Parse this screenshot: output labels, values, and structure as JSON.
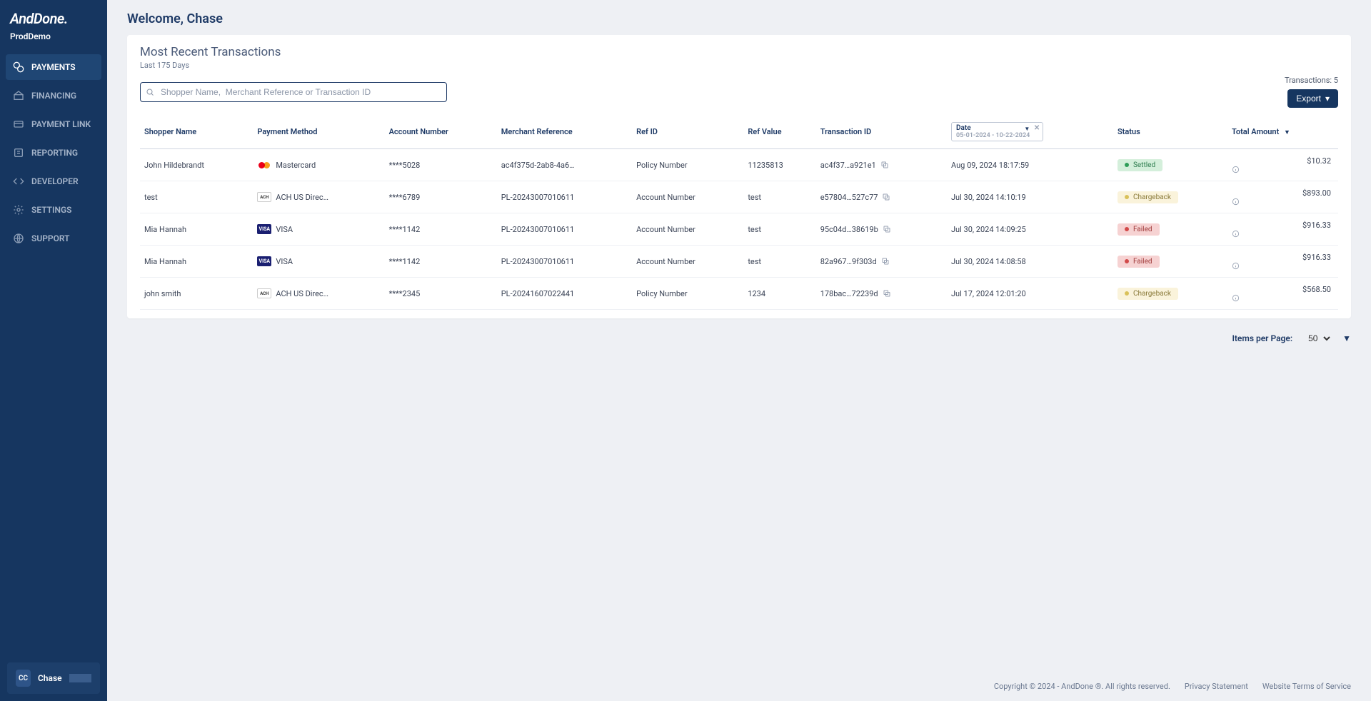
{
  "brand": "AndDone.",
  "tenant": "ProdDemo",
  "nav": {
    "items": [
      {
        "label": "PAYMENTS",
        "icon": "payments"
      },
      {
        "label": "FINANCING",
        "icon": "financing"
      },
      {
        "label": "PAYMENT LINK",
        "icon": "paymentlink"
      },
      {
        "label": "REPORTING",
        "icon": "reporting"
      },
      {
        "label": "DEVELOPER",
        "icon": "developer"
      },
      {
        "label": "SETTINGS",
        "icon": "settings"
      },
      {
        "label": "SUPPORT",
        "icon": "support"
      }
    ],
    "active_index": 0
  },
  "user": {
    "initials": "CC",
    "name": "Chase"
  },
  "header": {
    "welcome": "Welcome, Chase"
  },
  "card": {
    "title": "Most Recent Transactions",
    "subtitle": "Last 175 Days",
    "search_placeholder": "Shopper Name,  Merchant Reference or Transaction ID",
    "tx_count_label": "Transactions: 5",
    "export_label": "Export",
    "date_filter": {
      "label": "Date",
      "range": "05-01-2024 - 10-22-2024"
    }
  },
  "columns": {
    "shopper": "Shopper Name",
    "method": "Payment Method",
    "account": "Account Number",
    "merchant": "Merchant Reference",
    "refid": "Ref ID",
    "refval": "Ref Value",
    "txid": "Transaction ID",
    "date": "Date",
    "status": "Status",
    "amount": "Total Amount"
  },
  "rows": [
    {
      "shopper": "John Hildebrandt",
      "method": "Mastercard",
      "method_logo": "mc",
      "account": "****5028",
      "merchant": "ac4f375d-2ab8-4a6…",
      "refid": "Policy Number",
      "refval": "11235813",
      "txid": "ac4f37…a921e1",
      "date": "Aug 09, 2024 18:17:59",
      "status": "Settled",
      "status_class": "settled",
      "amount": "$10.32"
    },
    {
      "shopper": "test",
      "method": "ACH US Direc…",
      "method_logo": "ach",
      "account": "****6789",
      "merchant": "PL-20243007010611",
      "refid": "Account Number",
      "refval": "test",
      "txid": "e57804…527c77",
      "date": "Jul 30, 2024 14:10:19",
      "status": "Chargeback",
      "status_class": "chargeback",
      "amount": "$893.00"
    },
    {
      "shopper": "Mia Hannah",
      "method": "VISA",
      "method_logo": "visa",
      "account": "****1142",
      "merchant": "PL-20243007010611",
      "refid": "Account Number",
      "refval": "test",
      "txid": "95c04d…38619b",
      "date": "Jul 30, 2024 14:09:25",
      "status": "Failed",
      "status_class": "failed",
      "amount": "$916.33"
    },
    {
      "shopper": "Mia Hannah",
      "method": "VISA",
      "method_logo": "visa",
      "account": "****1142",
      "merchant": "PL-20243007010611",
      "refid": "Account Number",
      "refval": "test",
      "txid": "82a967…9f303d",
      "date": "Jul 30, 2024 14:08:58",
      "status": "Failed",
      "status_class": "failed",
      "amount": "$916.33"
    },
    {
      "shopper": "john smith",
      "method": "ACH US Direc…",
      "method_logo": "ach",
      "account": "****2345",
      "merchant": "PL-20241607022441",
      "refid": "Policy Number",
      "refval": "1234",
      "txid": "178bac…72239d",
      "date": "Jul 17, 2024 12:01:20",
      "status": "Chargeback",
      "status_class": "chargeback",
      "amount": "$568.50"
    }
  ],
  "pager": {
    "label": "Items per Page:",
    "value": "50"
  },
  "footer": {
    "copyright": "Copyright © 2024 - AndDone ®. All rights reserved.",
    "privacy": "Privacy Statement",
    "terms": "Website Terms of Service"
  }
}
